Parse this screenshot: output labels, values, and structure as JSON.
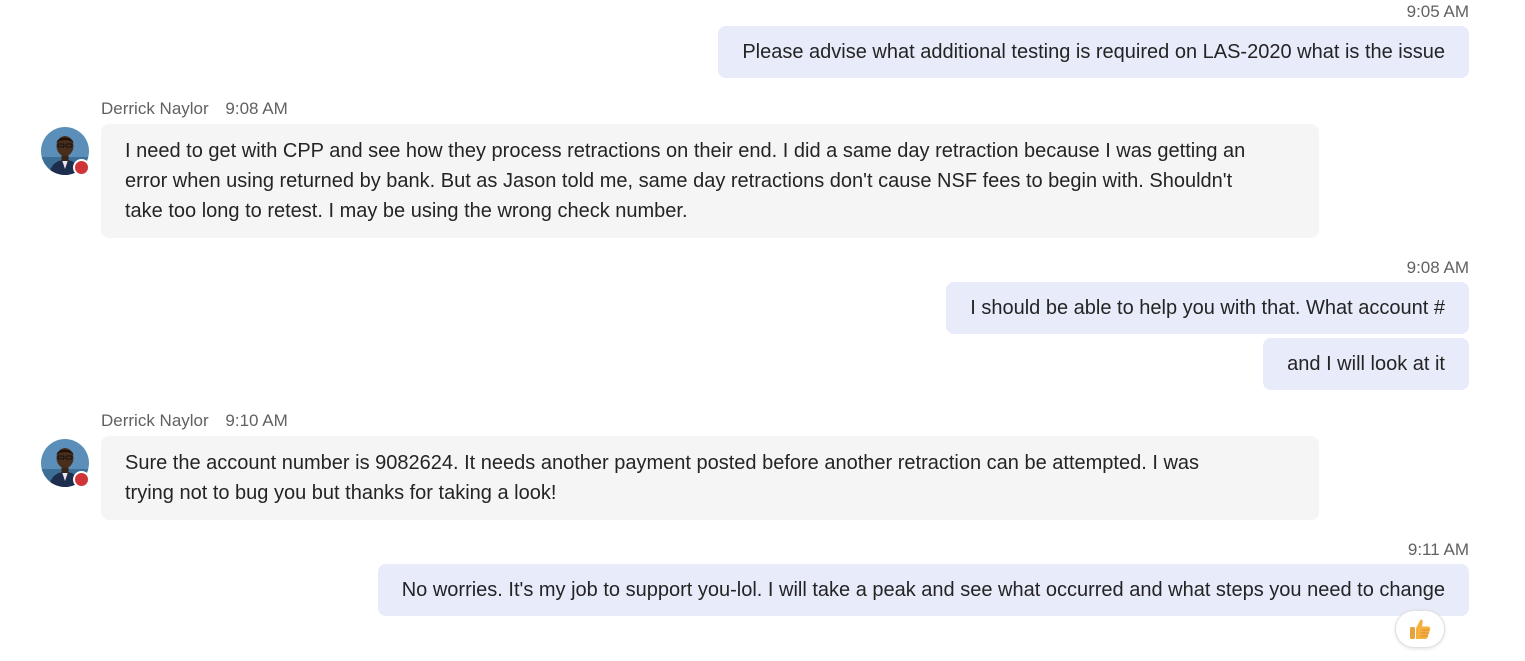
{
  "colors": {
    "outgoing_bubble": "#e8ebfa",
    "incoming_bubble": "#f5f5f5",
    "timestamp_text": "#616161",
    "presence_busy": "#d13438",
    "reaction_like": "#f5b041"
  },
  "messages": [
    {
      "direction": "outgoing",
      "time": "9:05 AM",
      "text": "Please advise what additional testing is required on LAS-2020 what is the issue"
    },
    {
      "direction": "incoming",
      "sender": "Derrick Naylor",
      "time": "9:08 AM",
      "presence": "busy",
      "lines": [
        "I need to get with CPP and see how they process retractions on their end. I did a same day retraction because I was getting an",
        "error when using returned by bank. But as Jason told me, same day retractions don't cause NSF fees to begin with. Shouldn't",
        "take too long to retest. I may be using the wrong check number."
      ]
    },
    {
      "direction": "outgoing",
      "time": "9:08 AM",
      "text": "I should be able to help you with that. What account #"
    },
    {
      "direction": "outgoing",
      "text": "and I will look at it"
    },
    {
      "direction": "incoming",
      "sender": "Derrick Naylor",
      "time": "9:10 AM",
      "presence": "busy",
      "lines": [
        "Sure the account number is 9082624. It needs another payment posted before another retraction can be attempted. I was",
        "trying not to bug you but thanks for taking a look!"
      ]
    },
    {
      "direction": "outgoing",
      "time": "9:11 AM",
      "text": "No worries. It's my job to support you-lol. I will take a peak and see what occurred and what steps you need to change",
      "reaction": "like-thumbs-up-icon"
    }
  ]
}
